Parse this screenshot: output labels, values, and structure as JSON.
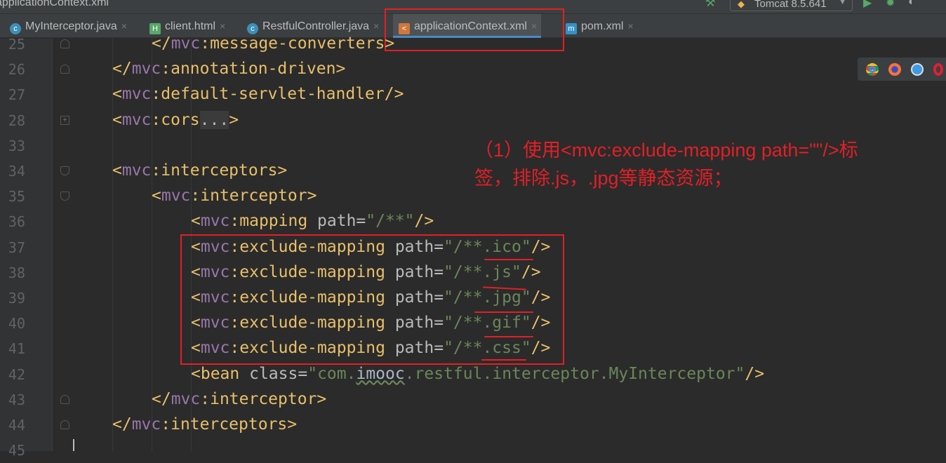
{
  "window": {
    "title": "applicationContext.xml"
  },
  "toolbar": {
    "run_config": "Tomcat 8.5.641"
  },
  "tabs": [
    {
      "label": "MyInterceptor.java",
      "icon": "java-class-icon",
      "color": "#3d8fb8",
      "glyph": "c"
    },
    {
      "label": "client.html",
      "icon": "html-file-icon",
      "color": "#59a869",
      "glyph": "H"
    },
    {
      "label": "RestfulController.java",
      "icon": "java-class-icon",
      "color": "#3d8fb8",
      "glyph": "c"
    },
    {
      "label": "applicationContext.xml",
      "icon": "spring-xml-icon",
      "color": "#d0773b",
      "glyph": "<",
      "active": true
    },
    {
      "label": "pom.xml",
      "icon": "maven-icon",
      "color": "#3592c4",
      "glyph": "m"
    }
  ],
  "annotation": {
    "line1": "（1）使用<mvc:exclude-mapping path=\"\"/>标",
    "line2": "签，排除.js，.jpg等静态资源；"
  },
  "browsers": [
    "chrome",
    "firefox",
    "safari",
    "opera"
  ],
  "code_lines": [
    {
      "n": "25",
      "indent": 2,
      "fold": "end",
      "tokens": [
        [
          "br",
          "</"
        ],
        [
          "ns",
          "mvc"
        ],
        [
          "tag",
          ":message-converters"
        ],
        [
          "br",
          ">"
        ]
      ]
    },
    {
      "n": "26",
      "indent": 1,
      "fold": "end",
      "tokens": [
        [
          "br",
          "</"
        ],
        [
          "ns",
          "mvc"
        ],
        [
          "tag",
          ":annotation-driven"
        ],
        [
          "br",
          ">"
        ]
      ]
    },
    {
      "n": "27",
      "indent": 1,
      "tokens": [
        [
          "br",
          "<"
        ],
        [
          "ns",
          "mvc"
        ],
        [
          "tag",
          ":default-servlet-handler"
        ],
        [
          "br",
          "/>"
        ]
      ]
    },
    {
      "n": "28",
      "indent": 1,
      "fold": "plus",
      "tokens": [
        [
          "br",
          "<"
        ],
        [
          "ns",
          "mvc"
        ],
        [
          "tag",
          ":cors"
        ],
        [
          "fold",
          "..."
        ],
        [
          "br",
          ">"
        ]
      ]
    },
    {
      "n": "33",
      "indent": 0,
      "tokens": []
    },
    {
      "n": "34",
      "indent": 1,
      "fold": "start",
      "tokens": [
        [
          "br",
          "<"
        ],
        [
          "ns",
          "mvc"
        ],
        [
          "tag",
          ":interceptors"
        ],
        [
          "br",
          ">"
        ]
      ]
    },
    {
      "n": "35",
      "indent": 2,
      "fold": "start",
      "tokens": [
        [
          "br",
          "<"
        ],
        [
          "ns",
          "mvc"
        ],
        [
          "tag",
          ":interceptor"
        ],
        [
          "br",
          ">"
        ]
      ]
    },
    {
      "n": "36",
      "indent": 3,
      "tokens": [
        [
          "br",
          "<"
        ],
        [
          "ns",
          "mvc"
        ],
        [
          "tag",
          ":mapping "
        ],
        [
          "attr",
          "path"
        ],
        [
          "eq",
          "="
        ],
        [
          "val",
          "\"/**\""
        ],
        [
          "br",
          "/>"
        ]
      ]
    },
    {
      "n": "37",
      "indent": 3,
      "tokens": [
        [
          "br",
          "<"
        ],
        [
          "ns",
          "mvc"
        ],
        [
          "tag",
          ":exclude-mapping "
        ],
        [
          "attr",
          "path"
        ],
        [
          "eq",
          "="
        ],
        [
          "val",
          "\"/**.ico\""
        ],
        [
          "br",
          "/>"
        ]
      ]
    },
    {
      "n": "38",
      "indent": 3,
      "tokens": [
        [
          "br",
          "<"
        ],
        [
          "ns",
          "mvc"
        ],
        [
          "tag",
          ":exclude-mapping "
        ],
        [
          "attr",
          "path"
        ],
        [
          "eq",
          "="
        ],
        [
          "val",
          "\"/**.js\""
        ],
        [
          "br",
          "/>"
        ]
      ]
    },
    {
      "n": "39",
      "indent": 3,
      "tokens": [
        [
          "br",
          "<"
        ],
        [
          "ns",
          "mvc"
        ],
        [
          "tag",
          ":exclude-mapping "
        ],
        [
          "attr",
          "path"
        ],
        [
          "eq",
          "="
        ],
        [
          "val",
          "\"/**.jpg\""
        ],
        [
          "br",
          "/>"
        ]
      ]
    },
    {
      "n": "40",
      "indent": 3,
      "tokens": [
        [
          "br",
          "<"
        ],
        [
          "ns",
          "mvc"
        ],
        [
          "tag",
          ":exclude-mapping "
        ],
        [
          "attr",
          "path"
        ],
        [
          "eq",
          "="
        ],
        [
          "val",
          "\"/**.gif\""
        ],
        [
          "br",
          "/>"
        ]
      ]
    },
    {
      "n": "41",
      "indent": 3,
      "tokens": [
        [
          "br",
          "<"
        ],
        [
          "ns",
          "mvc"
        ],
        [
          "tag",
          ":exclude-mapping "
        ],
        [
          "attr",
          "path"
        ],
        [
          "eq",
          "="
        ],
        [
          "val",
          "\"/**.css\""
        ],
        [
          "br",
          "/>"
        ]
      ]
    },
    {
      "n": "42",
      "indent": 3,
      "tokens": [
        [
          "br",
          "<"
        ],
        [
          "tag",
          "bean "
        ],
        [
          "attr",
          "class"
        ],
        [
          "eq",
          "="
        ],
        [
          "val",
          "\"com."
        ],
        [
          "typo",
          "imooc"
        ],
        [
          "val",
          ".restful.interceptor.MyInterceptor\""
        ],
        [
          "br",
          "/>"
        ]
      ]
    },
    {
      "n": "43",
      "indent": 2,
      "fold": "end",
      "tokens": [
        [
          "br",
          "</"
        ],
        [
          "ns",
          "mvc"
        ],
        [
          "tag",
          ":interceptor"
        ],
        [
          "br",
          ">"
        ]
      ]
    },
    {
      "n": "44",
      "indent": 1,
      "fold": "end",
      "tokens": [
        [
          "br",
          "</"
        ],
        [
          "ns",
          "mvc"
        ],
        [
          "tag",
          ":interceptors"
        ],
        [
          "br",
          ">"
        ]
      ]
    },
    {
      "n": "45",
      "indent": 0,
      "tokens": []
    }
  ]
}
